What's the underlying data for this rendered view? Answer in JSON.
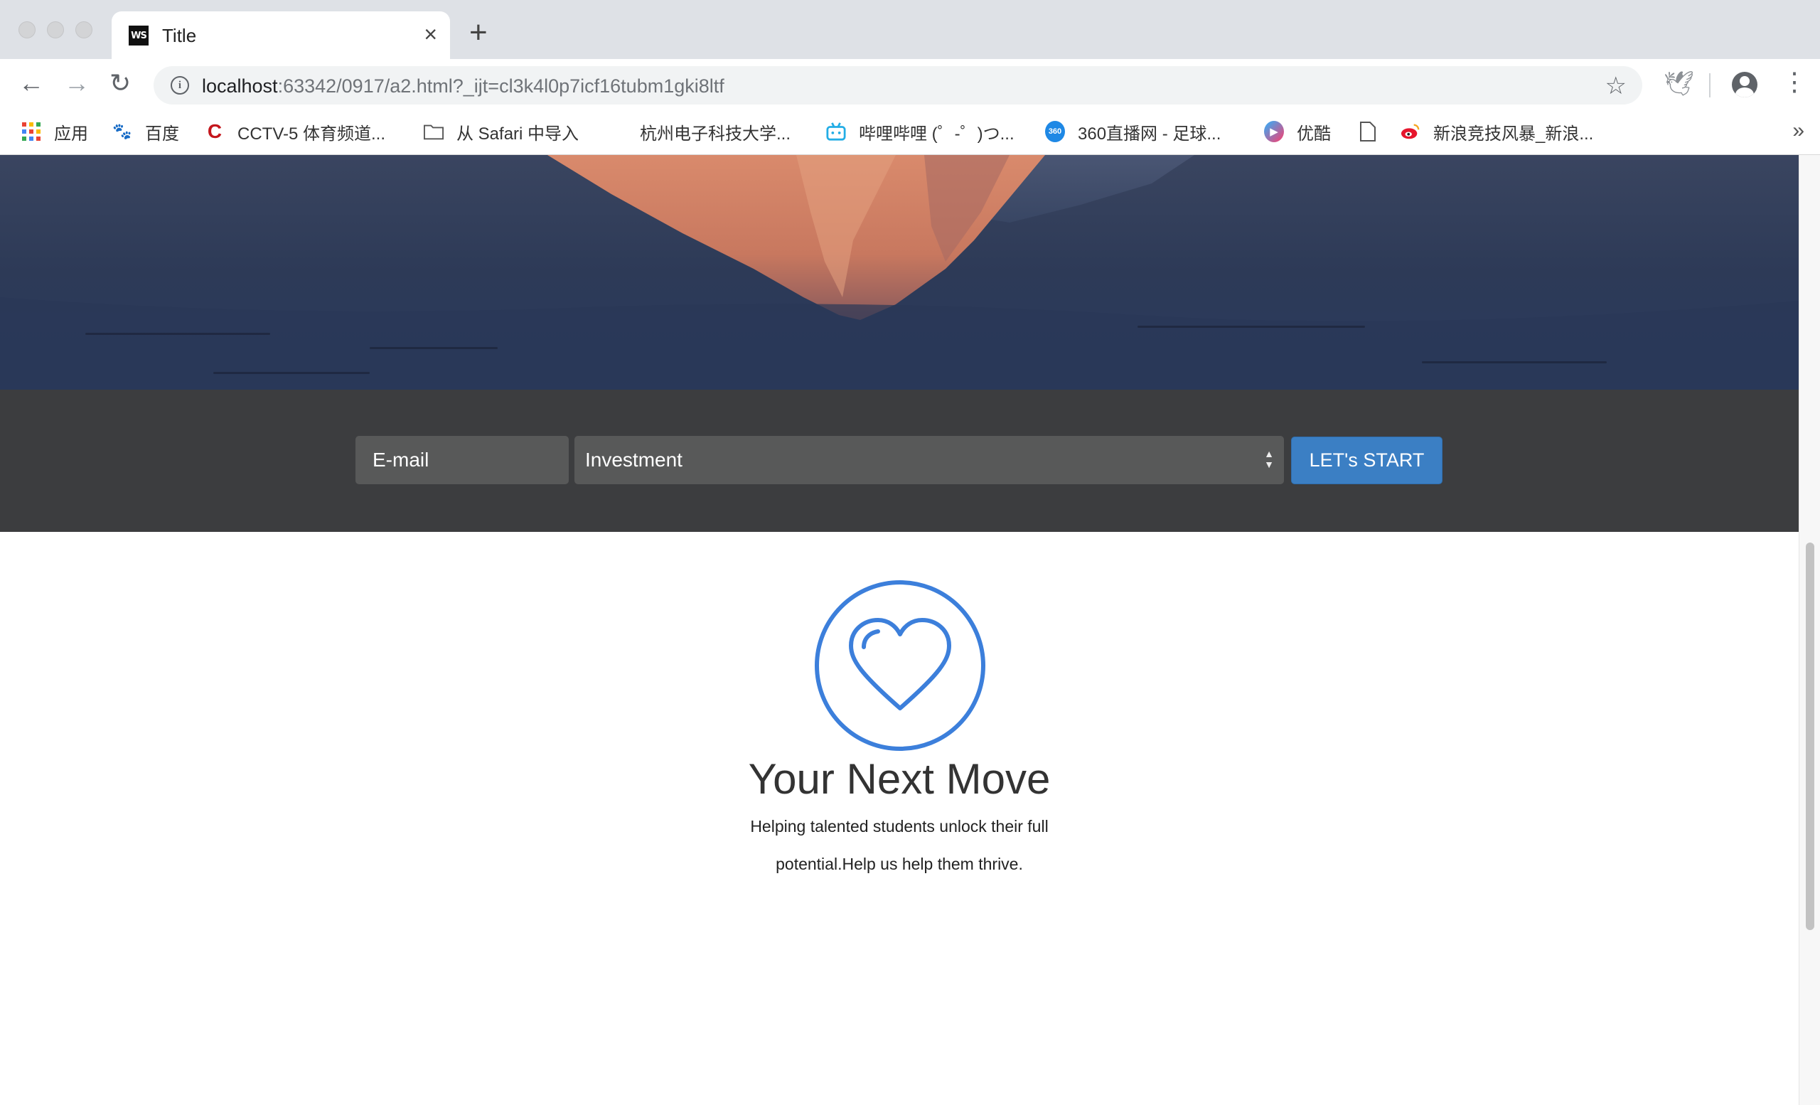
{
  "browser": {
    "tab_title": "Title",
    "tab_favicon": "WS",
    "close_icon": "×",
    "newtab_icon": "+",
    "url_host": "localhost",
    "url_rest": ":63342/0917/a2.html?_ijt=cl3k4l0p7icf16tubm1gki8ltf",
    "bookmarks": [
      {
        "label": "应用",
        "icon": "apps-grid-icon"
      },
      {
        "label": "百度",
        "icon": "baidu-paw-icon"
      },
      {
        "label": "CCTV-5 体育频道...",
        "icon": "cctv-icon"
      },
      {
        "label": "从 Safari 中导入",
        "icon": "folder-icon"
      },
      {
        "label": "杭州电子科技大学...",
        "icon": "none"
      },
      {
        "label": "哔哩哔哩 (゜-゜)つ...",
        "icon": "bilibili-icon"
      },
      {
        "label": "360直播网 - 足球...",
        "icon": "360-icon"
      },
      {
        "label": "优酷",
        "icon": "youku-icon"
      },
      {
        "label": "",
        "icon": "document-icon"
      },
      {
        "label": "新浪竞技风暴_新浪...",
        "icon": "weibo-icon"
      }
    ],
    "bookmarks_overflow": "»"
  },
  "form": {
    "email_placeholder": "E-mail",
    "select_value": "Investment",
    "button_label": "LET's START"
  },
  "feature": {
    "icon": "heart-icon",
    "title": "Your Next Move",
    "text": "Helping talented students unlock their full potential.Help us help them thrive."
  },
  "colors": {
    "accent_blue": "#3b7fc4",
    "heart_blue": "#3c7fdb",
    "form_band": "#3c3d3f",
    "field_bg": "#585959"
  }
}
